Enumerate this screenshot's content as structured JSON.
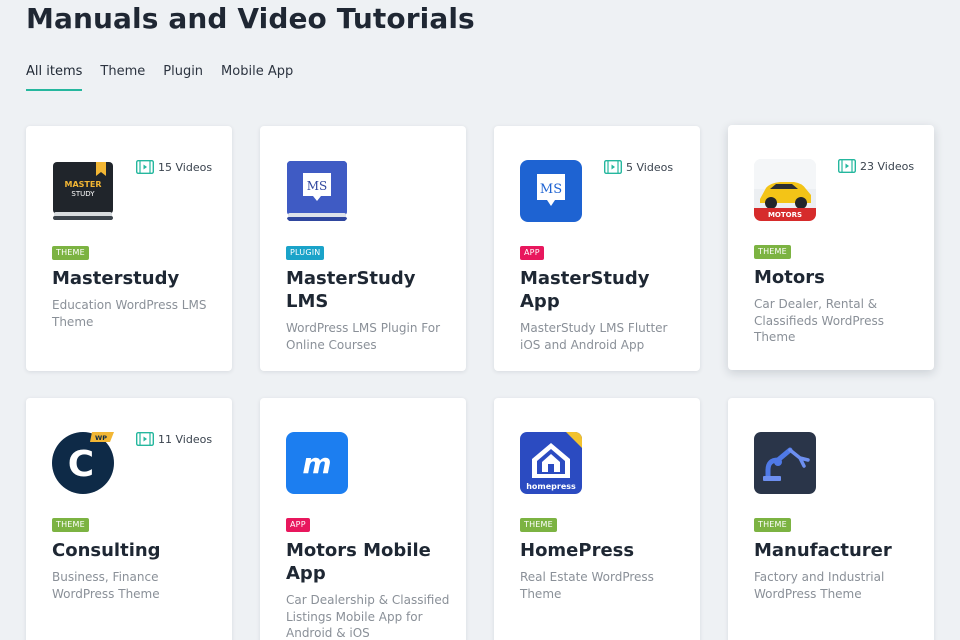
{
  "page": {
    "title": "Manuals and Video Tutorials"
  },
  "tabs": [
    {
      "label": "All items",
      "active": true
    },
    {
      "label": "Theme",
      "active": false
    },
    {
      "label": "Plugin",
      "active": false
    },
    {
      "label": "Mobile App",
      "active": false
    }
  ],
  "colors": {
    "accent": "#25b79e",
    "theme_badge": "#7cb342",
    "plugin_badge": "#1aa3c9",
    "app_badge": "#e8175d",
    "video_icon": "#25b79e"
  },
  "cards": [
    {
      "name": "Masterstudy",
      "badge": "THEME",
      "videos": "15 Videos",
      "desc": "Education WordPress LMS Theme",
      "icon": "masterstudy-book-logo",
      "logo_text_1": "MASTER",
      "logo_text_2": "STUDY"
    },
    {
      "name": "MasterStudy LMS",
      "badge": "PLUGIN",
      "videos": "",
      "desc": "WordPress LMS Plugin For Online Courses",
      "icon": "ms-book-logo",
      "logo_text_1": "MS"
    },
    {
      "name": "MasterStudy App",
      "badge": "APP",
      "videos": "5 Videos",
      "desc": "MasterStudy LMS Flutter iOS and Android App",
      "icon": "ms-app-logo",
      "logo_text_1": "MS"
    },
    {
      "name": "Motors",
      "badge": "THEME",
      "videos": "23 Videos",
      "desc": "Car Dealer, Rental & Classifieds WordPress Theme",
      "icon": "motors-car-logo",
      "logo_text_1": "MOTORS"
    },
    {
      "name": "Consulting",
      "badge": "THEME",
      "videos": "11 Videos",
      "desc": "Business, Finance WordPress Theme",
      "icon": "consulting-c-logo",
      "logo_text_1": "C",
      "logo_text_2": "WP"
    },
    {
      "name": "Motors Mobile App",
      "badge": "APP",
      "videos": "",
      "desc": "Car Dealership & Classified Listings Mobile App for Android & iOS",
      "icon": "motors-m-logo",
      "logo_text_1": "m"
    },
    {
      "name": "HomePress",
      "badge": "THEME",
      "videos": "",
      "desc": "Real Estate WordPress Theme",
      "icon": "homepress-house-logo",
      "logo_text_1": "homepress"
    },
    {
      "name": "Manufacturer",
      "badge": "THEME",
      "videos": "",
      "desc": "Factory and Industrial WordPress Theme",
      "icon": "manufacturer-robot-arm-logo"
    }
  ]
}
